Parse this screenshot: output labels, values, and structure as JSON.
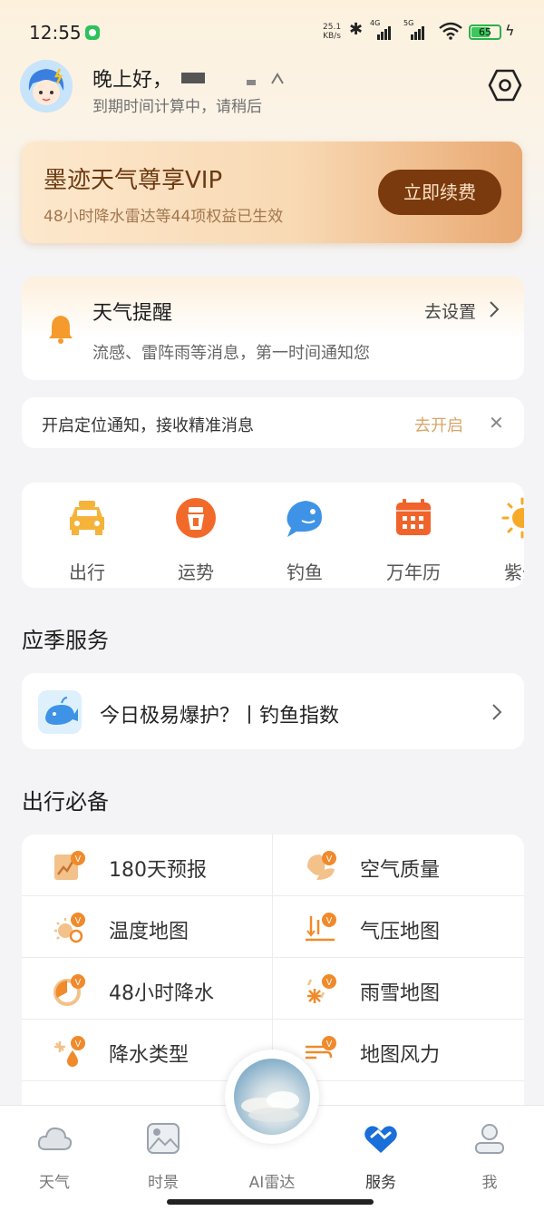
{
  "status_bar": {
    "time": "12:55",
    "net_speed_value": "25.1",
    "net_speed_unit": "KB/s",
    "signal1": "4G",
    "signal2": "5G",
    "wifi_num": "6",
    "battery": "65"
  },
  "header": {
    "greeting": "晚上好，",
    "expiry_text": "到期时间计算中，请稍后"
  },
  "vip": {
    "title": "墨迹天气尊享VIP",
    "subtitle": "48小时降水雷达等44项权益已生效",
    "renew_button": "立即续费"
  },
  "reminder": {
    "title": "天气提醒",
    "settings_link": "去设置",
    "description": "流感、雷阵雨等消息，第一时间通知您"
  },
  "location_notice": {
    "text": "开启定位通知，接收精准消息",
    "action": "去开启",
    "close_glyph": "✕"
  },
  "quick_tools": [
    {
      "label": "出行",
      "icon": "car-icon"
    },
    {
      "label": "运势",
      "icon": "fortune-icon"
    },
    {
      "label": "钓鱼",
      "icon": "fish-icon"
    },
    {
      "label": "万年历",
      "icon": "calendar-icon"
    },
    {
      "label": "紫外",
      "icon": "sun-icon"
    }
  ],
  "seasonal": {
    "section_title": "应季服务",
    "item_text": "今日极易爆护？丨钓鱼指数"
  },
  "travel": {
    "section_title": "出行必备",
    "items": [
      {
        "label": "180天预报",
        "icon": "forecast-180-icon"
      },
      {
        "label": "空气质量",
        "icon": "air-quality-icon"
      },
      {
        "label": "温度地图",
        "icon": "temperature-map-icon"
      },
      {
        "label": "气压地图",
        "icon": "pressure-map-icon"
      },
      {
        "label": "48小时降水",
        "icon": "precipitation-48h-icon"
      },
      {
        "label": "雨雪地图",
        "icon": "rain-snow-map-icon"
      },
      {
        "label": "降水类型",
        "icon": "precipitation-type-icon"
      },
      {
        "label": "地图风力",
        "icon": "wind-map-icon"
      }
    ]
  },
  "tabbar": {
    "items": [
      {
        "label": "天气",
        "icon": "weather-tab-icon"
      },
      {
        "label": "时景",
        "icon": "scenery-tab-icon"
      },
      {
        "label": "AI雷达",
        "icon": "ai-radar-tab-icon"
      },
      {
        "label": "服务",
        "icon": "service-tab-icon"
      },
      {
        "label": "我",
        "icon": "profile-tab-icon"
      }
    ],
    "active": "服务"
  },
  "colors": {
    "accent_orange": "#f08a2b",
    "vip_brown": "#7a3a0e",
    "link_gold": "#d8a56a",
    "service_blue": "#1a6fd8"
  }
}
